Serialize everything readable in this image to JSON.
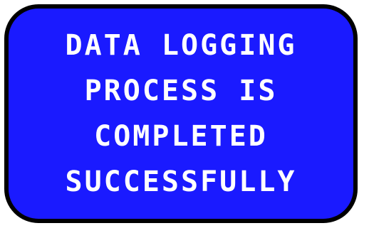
{
  "display": {
    "background_color": "#1a1aff",
    "border_color": "#000000",
    "text_color": "#ffffff",
    "lines": [
      "DATA LOGGING",
      "PROCESS IS",
      "COMPLETED",
      "SUCCESSFULLY"
    ]
  }
}
